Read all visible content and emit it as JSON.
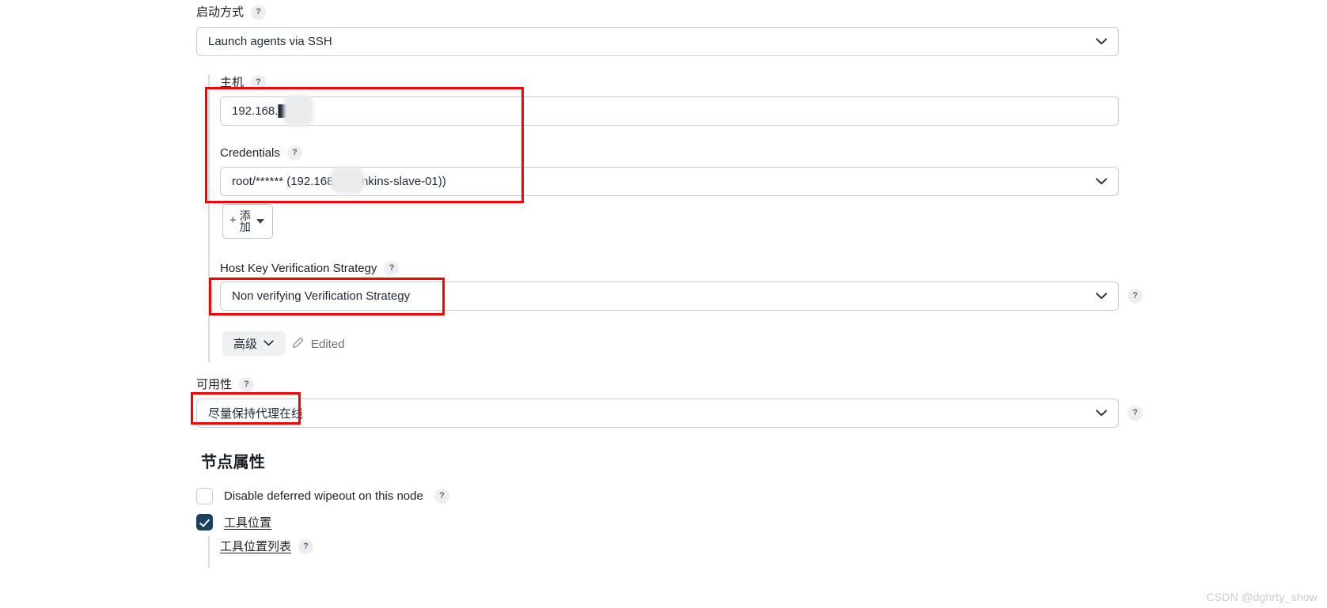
{
  "colors": {
    "accent_redbox": "#fb0000",
    "checkbox_checked": "#1b4160",
    "border": "#c8ced6",
    "text": "#1f2937",
    "muted": "#6b727c"
  },
  "launch_method": {
    "label": "启动方式",
    "help": "?",
    "value": "Launch agents via SSH"
  },
  "host": {
    "label": "主机",
    "help": "?",
    "value": "192.168.█"
  },
  "credentials": {
    "label": "Credentials",
    "help": "?",
    "value": "root/****** (192.168█     (Jenkins-slave-01))",
    "add_button": {
      "plus": "+",
      "line1": "添",
      "line2": "加"
    }
  },
  "host_key_strategy": {
    "label": "Host Key Verification Strategy",
    "help": "?",
    "value": "Non verifying Verification Strategy",
    "right_help": "?"
  },
  "advanced": {
    "button_label": "高级",
    "edited_label": "Edited",
    "pencil_icon": "pencil-icon"
  },
  "availability": {
    "label": "可用性",
    "help": "?",
    "value": "尽量保持代理在线",
    "right_help": "?"
  },
  "node_properties": {
    "title": "节点属性",
    "items": [
      {
        "label": "Disable deferred wipeout on this node",
        "checked": false,
        "help": "?",
        "link": false
      },
      {
        "label": "工具位置",
        "checked": true,
        "help": null,
        "link": true
      }
    ],
    "sub_item": {
      "label": "工具位置列表",
      "help": "?"
    }
  },
  "watermark": "CSDN @dghrty_show"
}
